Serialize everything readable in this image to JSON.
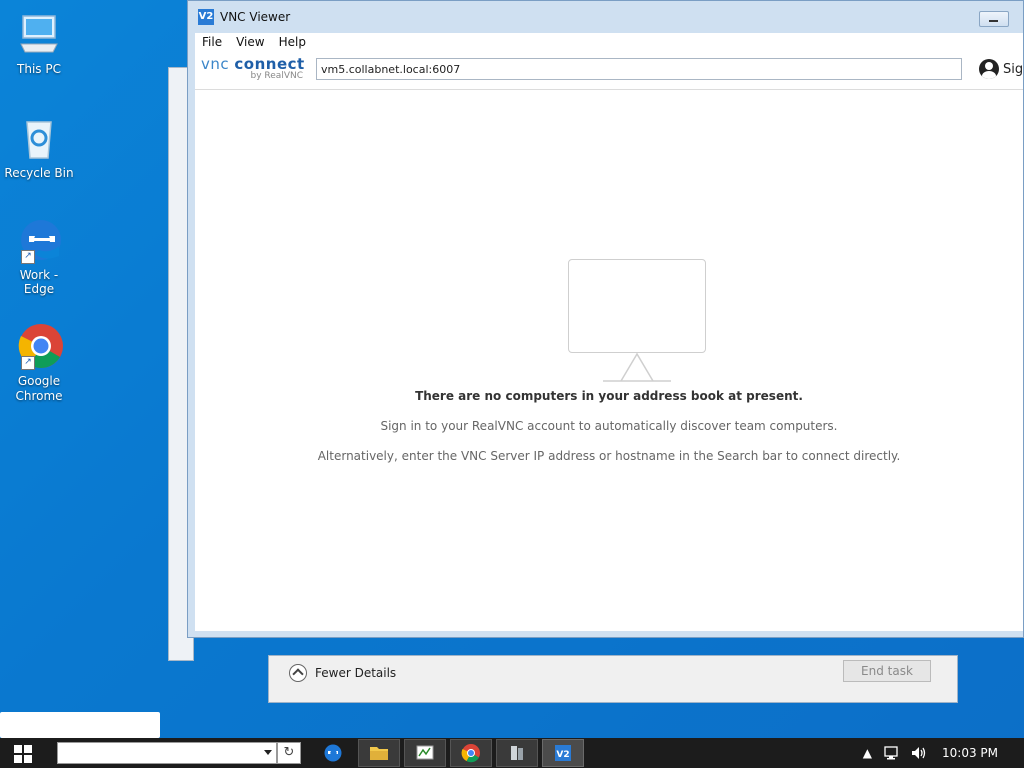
{
  "desktop": {
    "icons": [
      {
        "label": "This PC"
      },
      {
        "label": "Recycle Bin"
      },
      {
        "label": "Work - Edge"
      },
      {
        "label": "Google Chrome"
      }
    ]
  },
  "vnc": {
    "title": "VNC Viewer",
    "title_icon": "V2",
    "menu": [
      "File",
      "View",
      "Help"
    ],
    "logo_main_a": "vnc ",
    "logo_main_b": "connect",
    "logo_sub": "by RealVNC",
    "address_value": "vm5.collabnet.local:6007",
    "sign_in_label": "Sign",
    "empty_title": "There are no computers in your address book at present.",
    "empty_line1": "Sign in to your RealVNC account to automatically discover team computers.",
    "empty_line2": "Alternatively, enter the VNC Server IP address or hostname in the Search bar to connect directly."
  },
  "task_manager": {
    "fewer_details": "Fewer Details",
    "end_task": "End task"
  },
  "taskbar": {
    "clock": "10:03 PM",
    "apps": [
      "edge-icon",
      "file-explorer-icon",
      "task-manager-icon",
      "chrome-icon",
      "server-icon",
      "vnc-viewer-icon"
    ]
  },
  "colors": {
    "desktop_bg": "#0b84d8",
    "vnc_accent": "#3b86c9",
    "taskbar_bg": "#1c1c1c"
  }
}
